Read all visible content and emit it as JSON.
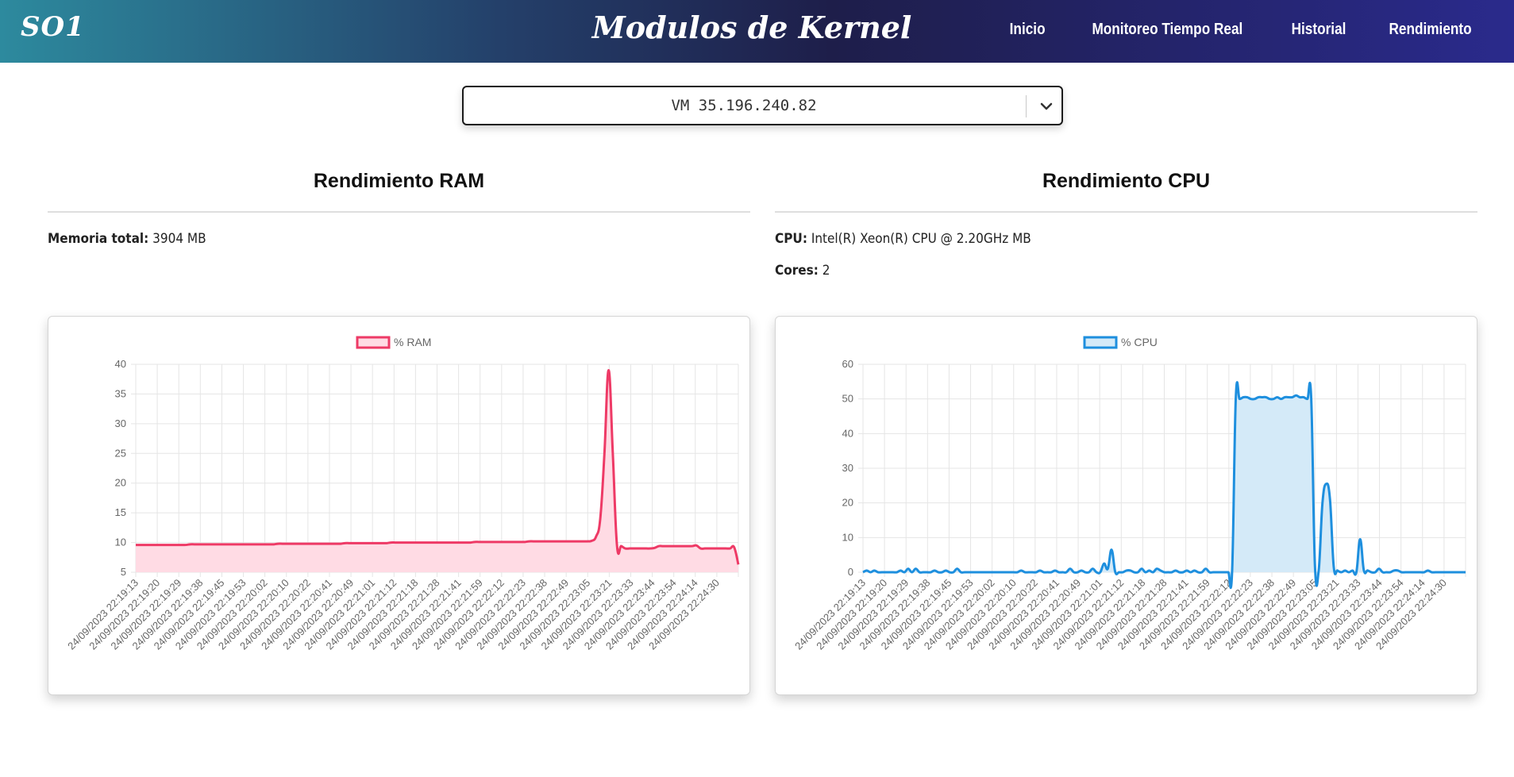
{
  "navbar": {
    "brand": "SO1",
    "title": "Modulos de Kernel",
    "links": [
      "Inicio",
      "Monitoreo Tiempo Real",
      "Historial",
      "Rendimiento"
    ]
  },
  "vm_select": {
    "selected": "VM 35.196.240.82"
  },
  "ram": {
    "title": "Rendimiento RAM",
    "total_label": "Memoria total:",
    "total_value": "3904 MB"
  },
  "cpu": {
    "title": "Rendimiento CPU",
    "cpu_label": "CPU:",
    "cpu_value": "Intel(R) Xeon(R) CPU @ 2.20GHz MB",
    "cores_label": "Cores:",
    "cores_value": "2"
  },
  "colors": {
    "ram_line": "#ee3a66",
    "ram_fill": "#ffdbe4",
    "cpu_line": "#1e8fde",
    "cpu_fill": "#d4eaf8"
  },
  "chart_data": [
    {
      "type": "area",
      "series": [
        {
          "name": "% RAM",
          "values": [
            9.6,
            9.6,
            9.6,
            9.6,
            9.6,
            9.6,
            9.6,
            9.6,
            9.6,
            9.6,
            9.6,
            9.6,
            9.6,
            9.7,
            9.7,
            9.7,
            9.7,
            9.7,
            9.7,
            9.7,
            9.7,
            9.7,
            9.7,
            9.7,
            9.7,
            9.7,
            9.7,
            9.7,
            9.7,
            9.7,
            9.7,
            9.7,
            9.7,
            9.7,
            9.8,
            9.8,
            9.8,
            9.8,
            9.8,
            9.8,
            9.8,
            9.8,
            9.8,
            9.8,
            9.8,
            9.8,
            9.8,
            9.8,
            9.8,
            9.8,
            9.9,
            9.9,
            9.9,
            9.9,
            9.9,
            9.9,
            9.9,
            9.9,
            9.9,
            9.9,
            9.9,
            10.0,
            10.0,
            10.0,
            10.0,
            10.0,
            10.0,
            10.0,
            10.0,
            10.0,
            10.0,
            10.0,
            10.0,
            10.0,
            10.0,
            10.0,
            10.0,
            10.0,
            10.0,
            10.0,
            10.0,
            10.1,
            10.1,
            10.1,
            10.1,
            10.1,
            10.1,
            10.1,
            10.1,
            10.1,
            10.1,
            10.1,
            10.1,
            10.1,
            10.2,
            10.2,
            10.2,
            10.2,
            10.2,
            10.2,
            10.2,
            10.2,
            10.2,
            10.2,
            10.2,
            10.2,
            10.2,
            10.2,
            10.2,
            10.3,
            11.0,
            14.0,
            25.0,
            39.0,
            25.0,
            9.5,
            9.4,
            9.0,
            9.0,
            9.0,
            9.0,
            9.0,
            9.0,
            9.0,
            9.1,
            9.4,
            9.4,
            9.4,
            9.4,
            9.4,
            9.4,
            9.4,
            9.4,
            9.4,
            9.5,
            9.0,
            9.0,
            9.0,
            9.0,
            9.0,
            9.0,
            9.0,
            9.0,
            9.2,
            6.3
          ]
        }
      ],
      "x_ticks": [
        "24/09/2023 22:19:13",
        "24/09/2023 22:19:20",
        "24/09/2023 22:19:29",
        "24/09/2023 22:19:38",
        "24/09/2023 22:19:45",
        "24/09/2023 22:19:53",
        "24/09/2023 22:20:02",
        "24/09/2023 22:20:10",
        "24/09/2023 22:20:22",
        "24/09/2023 22:20:41",
        "24/09/2023 22:20:49",
        "24/09/2023 22:21:01",
        "24/09/2023 22:21:12",
        "24/09/2023 22:21:18",
        "24/09/2023 22:21:28",
        "24/09/2023 22:21:41",
        "24/09/2023 22:21:59",
        "24/09/2023 22:22:12",
        "24/09/2023 22:22:23",
        "24/09/2023 22:22:38",
        "24/09/2023 22:22:49",
        "24/09/2023 22:23:05",
        "24/09/2023 22:23:21",
        "24/09/2023 22:23:33",
        "24/09/2023 22:23:44",
        "24/09/2023 22:23:54",
        "24/09/2023 22:24:14",
        "24/09/2023 22:24:30"
      ],
      "y_ticks": [
        5,
        10,
        15,
        20,
        25,
        30,
        35,
        40
      ],
      "ylim": [
        5,
        40
      ],
      "legend": "top",
      "grid": true
    },
    {
      "type": "area",
      "series": [
        {
          "name": "% CPU",
          "values": [
            0,
            0.5,
            0,
            0.5,
            0,
            0,
            0,
            0,
            0,
            0,
            0.5,
            0,
            1,
            0,
            1,
            0,
            0,
            0,
            0,
            0.5,
            0,
            0,
            0.5,
            0,
            0,
            1,
            0,
            0,
            0,
            0,
            0,
            0,
            0,
            0,
            0,
            0,
            0,
            0,
            0,
            0,
            0,
            0,
            0.5,
            0,
            0,
            0,
            0,
            0.5,
            0,
            0,
            0,
            0.5,
            0,
            0,
            0,
            1,
            0,
            0,
            0.5,
            0,
            0,
            1,
            0,
            0,
            2.5,
            1,
            6.5,
            0,
            0,
            0,
            0.5,
            0.5,
            0,
            0,
            1,
            0,
            0.5,
            0,
            1,
            0.5,
            0,
            0,
            0,
            0.5,
            0,
            0,
            0.5,
            0,
            0.5,
            0,
            0,
            1,
            0,
            0,
            0,
            0,
            0,
            0,
            0,
            50.5,
            50,
            50.5,
            50.5,
            50,
            50,
            50.5,
            50.5,
            50.5,
            50,
            50,
            50.5,
            50,
            50.5,
            50.5,
            50.5,
            51,
            50.5,
            50.5,
            50,
            50.5,
            2,
            0.5,
            20,
            25.5,
            21,
            1.5,
            0.5,
            0,
            0.5,
            0,
            0.5,
            0,
            9.5,
            0.5,
            0.5,
            0,
            0,
            1,
            0,
            0,
            0,
            0.5,
            0.5,
            0,
            0,
            0,
            0,
            0,
            0,
            0,
            0.5,
            0,
            0,
            0,
            0,
            0,
            0,
            0,
            0,
            0,
            0
          ]
        }
      ],
      "x_ticks": [
        "24/09/2023 22:19:13",
        "24/09/2023 22:19:20",
        "24/09/2023 22:19:29",
        "24/09/2023 22:19:38",
        "24/09/2023 22:19:45",
        "24/09/2023 22:19:53",
        "24/09/2023 22:20:02",
        "24/09/2023 22:20:10",
        "24/09/2023 22:20:22",
        "24/09/2023 22:20:41",
        "24/09/2023 22:20:49",
        "24/09/2023 22:21:01",
        "24/09/2023 22:21:12",
        "24/09/2023 22:21:18",
        "24/09/2023 22:21:28",
        "24/09/2023 22:21:41",
        "24/09/2023 22:21:59",
        "24/09/2023 22:22:12",
        "24/09/2023 22:22:23",
        "24/09/2023 22:22:38",
        "24/09/2023 22:22:49",
        "24/09/2023 22:23:05",
        "24/09/2023 22:23:21",
        "24/09/2023 22:23:33",
        "24/09/2023 22:23:44",
        "24/09/2023 22:23:54",
        "24/09/2023 22:24:14",
        "24/09/2023 22:24:30"
      ],
      "y_ticks": [
        0,
        10,
        20,
        30,
        40,
        50,
        60
      ],
      "ylim": [
        0,
        60
      ],
      "legend": "top",
      "grid": true
    }
  ]
}
